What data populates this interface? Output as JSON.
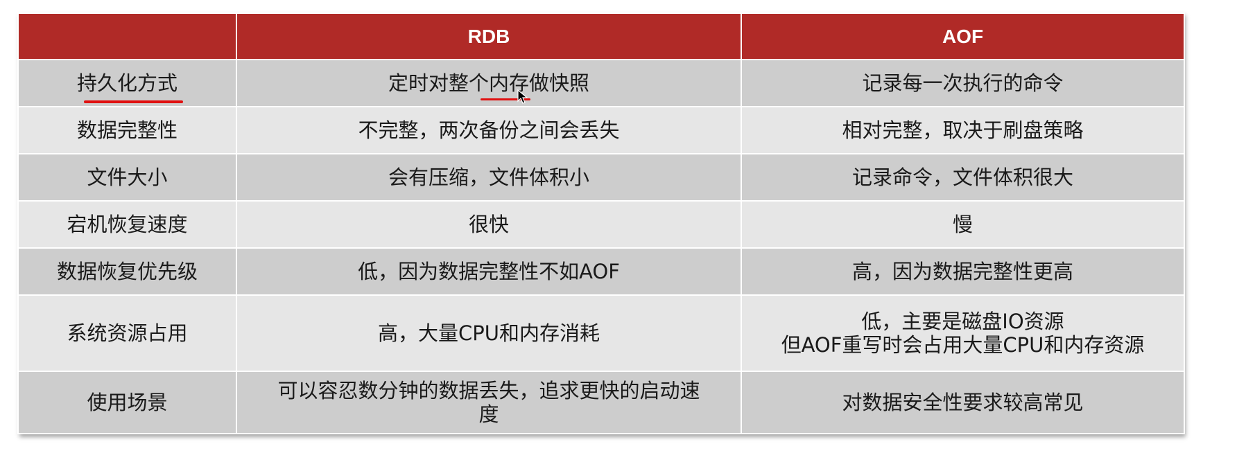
{
  "table": {
    "headers": [
      "",
      "RDB",
      "AOF"
    ],
    "rows": [
      {
        "label": "持久化方式",
        "rdb": "定时对整个内存做快照",
        "aof": "记录每一次执行的命令"
      },
      {
        "label": "数据完整性",
        "rdb": "不完整，两次备份之间会丢失",
        "aof": "相对完整，取决于刷盘策略"
      },
      {
        "label": "文件大小",
        "rdb": "会有压缩，文件体积小",
        "aof": "记录命令，文件体积很大"
      },
      {
        "label": "宕机恢复速度",
        "rdb": "很快",
        "aof": "慢"
      },
      {
        "label": "数据恢复优先级",
        "rdb": "低，因为数据完整性不如AOF",
        "aof": "高，因为数据完整性更高"
      },
      {
        "label": "系统资源占用",
        "rdb": "高，大量CPU和内存消耗",
        "aof_lines": [
          "低，主要是磁盘IO资源",
          "但AOF重写时会占用大量CPU和内存资源"
        ]
      },
      {
        "label": "使用场景",
        "rdb_lines": [
          "可以容忍数分钟的数据丢失，追求更快的启动速",
          "度"
        ],
        "aof": "对数据安全性要求较高常见"
      }
    ]
  },
  "colors": {
    "header_bg": "#b02a27",
    "row_dark": "#cdcdcd",
    "row_light": "#e6e6e6",
    "annotation_red": "#e01010"
  },
  "icons": {
    "cursor": "mouse-pointer-icon"
  }
}
